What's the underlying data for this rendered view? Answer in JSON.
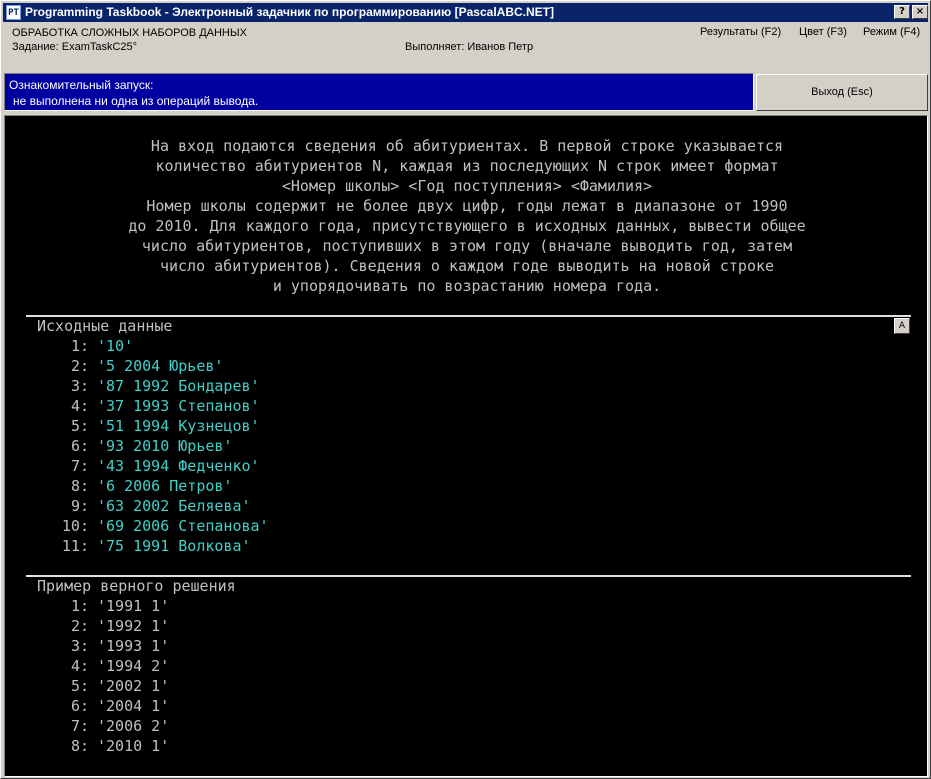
{
  "window": {
    "title": "Programming Taskbook - Электронный задачник по программированию [PascalABC.NET]",
    "icon_text": "PT",
    "help_label": "?",
    "close_label": "×"
  },
  "info": {
    "topic": "ОБРАБОТКА СЛОЖНЫХ НАБОРОВ ДАННЫХ",
    "task": "Задание: ExamTaskC25°",
    "executor": "Выполняет: Иванов Петр",
    "menu": {
      "results": "Результаты (F2)",
      "color": "Цвет (F3)",
      "mode": "Режим (F4)"
    }
  },
  "status": {
    "line1": "Ознакомительный запуск:",
    "line2": "не выполнена ни одна из операций вывода."
  },
  "exit_button": "Выход (Esc)",
  "description": [
    "На вход подаются сведения об абитуриентах. В первой строке указывается",
    "количество абитуриентов N, каждая из последующих N строк имеет формат",
    "<Номер школы> <Год поступления> <Фамилия>",
    "Номер школы содержит не более двух цифр, годы лежат в диапазоне от 1990",
    "до 2010. Для каждого года, присутствующего в исходных данных, вывести общее",
    "число абитуриентов, поступивших в этом году (вначале выводить год, затем",
    "число абитуриентов). Сведения о каждом годе выводить на новой строке",
    "и упорядочивать по возрастанию номера года."
  ],
  "input_section": {
    "title": "Исходные данные",
    "scroll_marker": "A",
    "rows": [
      {
        "idx": "1:",
        "val": "'10'"
      },
      {
        "idx": "2:",
        "val": "'5 2004 Юрьев'"
      },
      {
        "idx": "3:",
        "val": "'87 1992 Бондарев'"
      },
      {
        "idx": "4:",
        "val": "'37 1993 Степанов'"
      },
      {
        "idx": "5:",
        "val": "'51 1994 Кузнецов'"
      },
      {
        "idx": "6:",
        "val": "'93 2010 Юрьев'"
      },
      {
        "idx": "7:",
        "val": "'43 1994 Федченко'"
      },
      {
        "idx": "8:",
        "val": "'6 2006 Петров'"
      },
      {
        "idx": "9:",
        "val": "'63 2002 Беляева'"
      },
      {
        "idx": "10:",
        "val": "'69 2006 Степанова'"
      },
      {
        "idx": "11:",
        "val": "'75 1991 Волкова'"
      }
    ]
  },
  "output_section": {
    "title": "Пример верного решения",
    "rows": [
      {
        "idx": "1:",
        "val": "'1991 1'"
      },
      {
        "idx": "2:",
        "val": "'1992 1'"
      },
      {
        "idx": "3:",
        "val": "'1993 1'"
      },
      {
        "idx": "4:",
        "val": "'1994 2'"
      },
      {
        "idx": "5:",
        "val": "'2002 1'"
      },
      {
        "idx": "6:",
        "val": "'2004 1'"
      },
      {
        "idx": "7:",
        "val": "'2006 2'"
      },
      {
        "idx": "8:",
        "val": "'2010 1'"
      }
    ]
  }
}
